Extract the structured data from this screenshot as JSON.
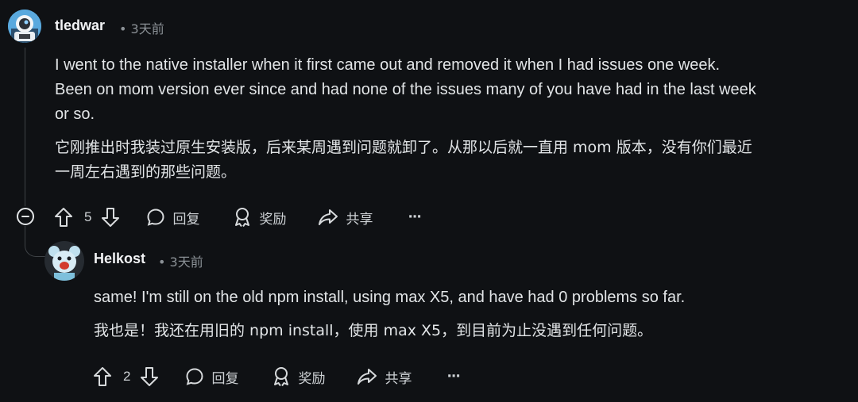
{
  "comments": [
    {
      "username": "tledwar",
      "time": "• 3天前",
      "paragraphs": [
        "I went to the native installer when it first came out and removed it when I had issues one week.",
        "Been on mom version ever since and had none of the issues many of you have had in the last week",
        "or so."
      ],
      "translation": [
        "它刚推出时我装过原生安装版，后来某周遇到问题就卸了。从那以后就一直用 mom 版本，没有你们最近",
        "一周左右遇到的那些问题。"
      ],
      "votes": "5",
      "actions": {
        "reply": "回复",
        "award": "奖励",
        "share": "共享",
        "more": "···"
      }
    },
    {
      "username": "Helkost",
      "time": "• 3天前",
      "paragraphs": [
        "same! I'm still on the old npm install, using max X5, and have had 0 problems so far."
      ],
      "translation": [
        "我也是！我还在用旧的 npm install，使用 max X5，到目前为止没遇到任何问题。"
      ],
      "votes": "2",
      "actions": {
        "reply": "回复",
        "award": "奖励",
        "share": "共享",
        "more": "···"
      }
    }
  ],
  "icons": {
    "upvote": "arrow-up-icon",
    "downvote": "arrow-down-icon",
    "reply": "speech-bubble-icon",
    "award": "award-icon",
    "share": "share-arrow-icon",
    "collapse": "collapse-minus-icon"
  }
}
